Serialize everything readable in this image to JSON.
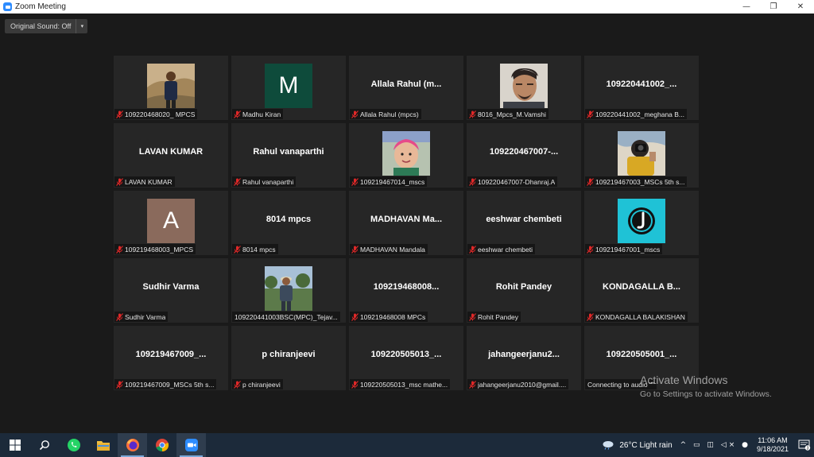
{
  "window": {
    "title": "Zoom Meeting",
    "minimize": "—",
    "restore": "❐",
    "close": "✕"
  },
  "toolbar": {
    "original_sound": "Original Sound: Off",
    "dropdown": "▾"
  },
  "tiles": [
    {
      "type": "photo",
      "photo": "man-rocks",
      "name": "109220468020_ MPCS"
    },
    {
      "type": "letter",
      "letter": "M",
      "bg": "#0e4b3b",
      "name": "Madhu Kiran"
    },
    {
      "type": "text",
      "display": "Allala Rahul (m...",
      "name": "Allala Rahul (mpcs)"
    },
    {
      "type": "photo",
      "photo": "man-selfie",
      "name": "8016_Mpcs_M.Vamshi"
    },
    {
      "type": "text",
      "display": "109220441002_...",
      "name": "109220441002_meghana B..."
    },
    {
      "type": "text",
      "display": "LAVAN KUMAR",
      "name": "LAVAN KUMAR"
    },
    {
      "type": "text",
      "display": "Rahul vanaparthi",
      "name": "Rahul vanaparthi"
    },
    {
      "type": "photo",
      "photo": "child",
      "name": "109219467014_mscs"
    },
    {
      "type": "text",
      "display": "109220467007-...",
      "name": "109220467007-Dhanraj.A"
    },
    {
      "type": "photo",
      "photo": "camera-person",
      "name": "109219467003_MSCs 5th s..."
    },
    {
      "type": "letter",
      "letter": "A",
      "bg": "#8a6a5c",
      "name": "109219468003_MPCS"
    },
    {
      "type": "text",
      "display": "8014 mpcs",
      "name": "8014 mpcs"
    },
    {
      "type": "text",
      "display": "MADHAVAN  Ma...",
      "name": "MADHAVAN Mandala"
    },
    {
      "type": "text",
      "display": "eeshwar chembeti",
      "name": "eeshwar chembeti"
    },
    {
      "type": "logo",
      "bg": "#1fc2d6",
      "name": "109219467001_mscs"
    },
    {
      "type": "text",
      "display": "Sudhir Varma",
      "name": "Sudhir Varma"
    },
    {
      "type": "photo",
      "photo": "man-outdoor",
      "name": "109220441003BSC(MPC)_Tejav...",
      "nomic": true
    },
    {
      "type": "text",
      "display": "109219468008...",
      "name": "109219468008 MPCs"
    },
    {
      "type": "text",
      "display": "Rohit Pandey",
      "name": "Rohit Pandey"
    },
    {
      "type": "text",
      "display": "KONDAGALLA B...",
      "name": "KONDAGALLA BALAKISHAN"
    },
    {
      "type": "text",
      "display": "109219467009_...",
      "name": "109219467009_MSCs 5th s..."
    },
    {
      "type": "text",
      "display": "p chiranjeevi",
      "name": "p chiranjeevi"
    },
    {
      "type": "text",
      "display": "109220505013_...",
      "name": "109220505013_msc mathe..."
    },
    {
      "type": "text",
      "display": "jahangeerjanu2...",
      "name": "jahangeerjanu2010@gmail...."
    },
    {
      "type": "text",
      "display": "109220505001_...",
      "name": "Connecting to audio \"\"",
      "nomic": true
    }
  ],
  "watermark": {
    "title": "Activate Windows",
    "subtitle": "Go to Settings to activate Windows."
  },
  "taskbar": {
    "apps": [
      "windows-start-icon",
      "search-icon",
      "whatsapp-icon",
      "file-explorer-icon",
      "firefox-icon",
      "chrome-icon",
      "zoom-icon"
    ],
    "weather": "26°C  Light rain",
    "tray_icons": "^ ▭ ◫ ◁× ●",
    "time": "11:06 AM",
    "date": "9/18/2021",
    "notifications": "3"
  },
  "colors": {
    "accent": "#2d8cff",
    "tile_bg": "#262626",
    "muted_mic": "#e02828"
  }
}
